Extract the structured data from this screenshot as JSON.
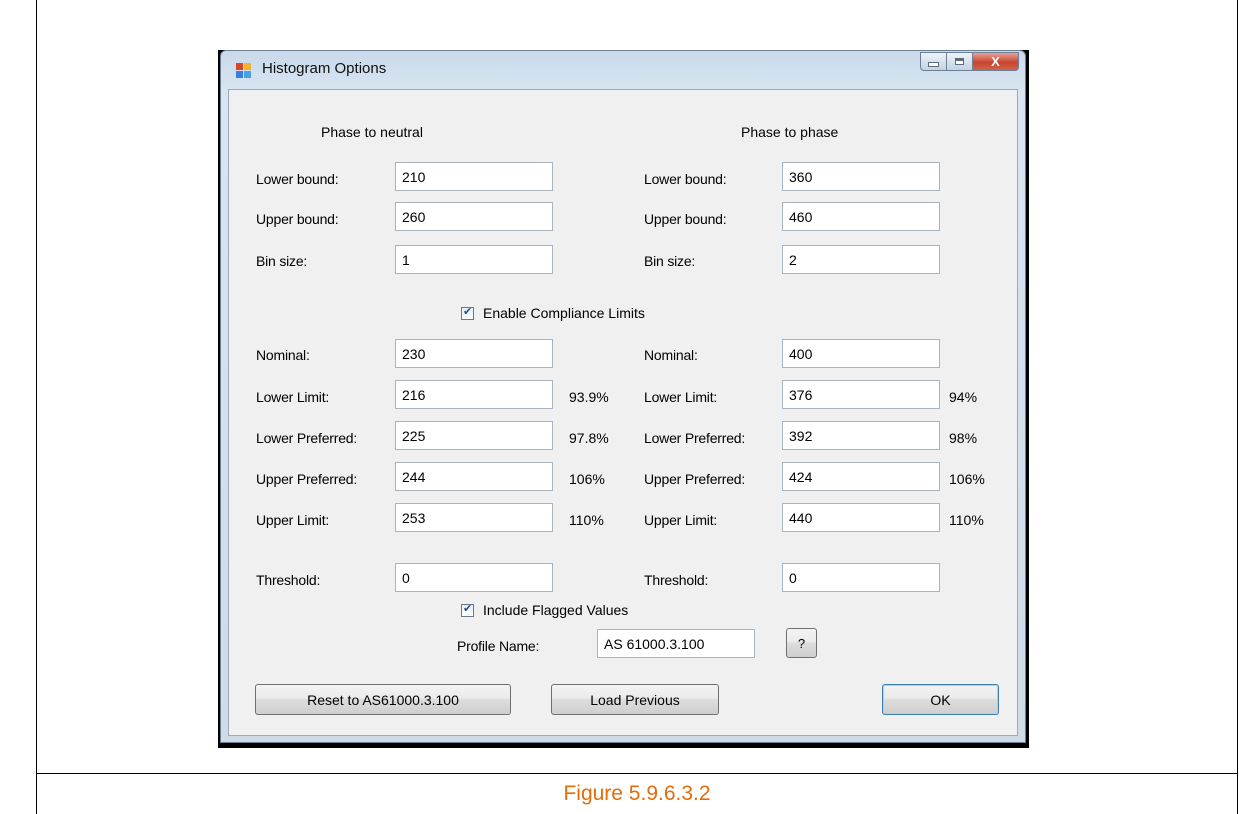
{
  "window": {
    "title": "Histogram Options",
    "close_label": "X"
  },
  "left": {
    "header": "Phase to neutral",
    "lower_bound_label": "Lower bound:",
    "lower_bound_value": "210",
    "upper_bound_label": "Upper bound:",
    "upper_bound_value": "260",
    "bin_size_label": "Bin size:",
    "bin_size_value": "1",
    "nominal_label": "Nominal:",
    "nominal_value": "230",
    "lower_limit_label": "Lower Limit:",
    "lower_limit_value": "216",
    "lower_limit_pct": "93.9%",
    "lower_preferred_label": "Lower Preferred:",
    "lower_preferred_value": "225",
    "lower_preferred_pct": "97.8%",
    "upper_preferred_label": "Upper Preferred:",
    "upper_preferred_value": "244",
    "upper_preferred_pct": "106%",
    "upper_limit_label": "Upper Limit:",
    "upper_limit_value": "253",
    "upper_limit_pct": "110%",
    "threshold_label": "Threshold:",
    "threshold_value": "0"
  },
  "right": {
    "header": "Phase to phase",
    "lower_bound_label": "Lower bound:",
    "lower_bound_value": "360",
    "upper_bound_label": "Upper bound:",
    "upper_bound_value": "460",
    "bin_size_label": "Bin size:",
    "bin_size_value": "2",
    "nominal_label": "Nominal:",
    "nominal_value": "400",
    "lower_limit_label": "Lower Limit:",
    "lower_limit_value": "376",
    "lower_limit_pct": "94%",
    "lower_preferred_label": "Lower Preferred:",
    "lower_preferred_value": "392",
    "lower_preferred_pct": "98%",
    "upper_preferred_label": "Upper Preferred:",
    "upper_preferred_value": "424",
    "upper_preferred_pct": "106%",
    "upper_limit_label": "Upper Limit:",
    "upper_limit_value": "440",
    "upper_limit_pct": "110%",
    "threshold_label": "Threshold:",
    "threshold_value": "0"
  },
  "options": {
    "enable_compliance_label": "Enable Compliance Limits",
    "enable_compliance_checked": true,
    "include_flagged_label": "Include Flagged Values",
    "include_flagged_checked": true,
    "profile_name_label": "Profile Name:",
    "profile_name_value": "AS 61000.3.100",
    "help_label": "?"
  },
  "buttons": {
    "reset_label": "Reset to AS61000.3.100",
    "load_previous_label": "Load Previous",
    "ok_label": "OK"
  },
  "caption": {
    "text": "Figure 5.9.6.3.2",
    "color": "#e46c0a"
  },
  "colors": {
    "close_button": "#c7452d",
    "dialog_background": "#f0f0f0"
  }
}
